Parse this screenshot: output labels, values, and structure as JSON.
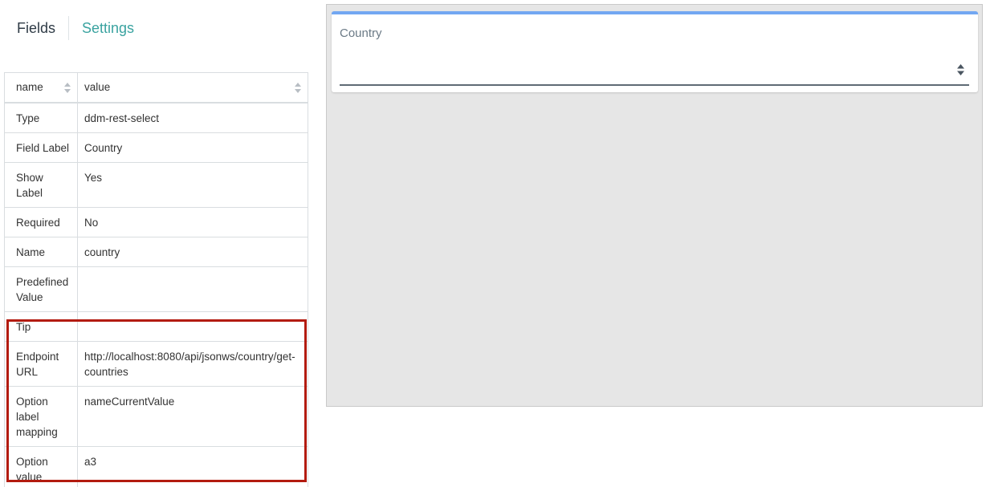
{
  "tabs": {
    "fields": "Fields",
    "settings": "Settings"
  },
  "table": {
    "headers": {
      "name": "name",
      "value": "value"
    },
    "rows": [
      {
        "name": "Type",
        "value": "ddm-rest-select"
      },
      {
        "name": "Field Label",
        "value": "Country"
      },
      {
        "name": "Show Label",
        "value": "Yes"
      },
      {
        "name": "Required",
        "value": "No"
      },
      {
        "name": "Name",
        "value": "country"
      },
      {
        "name": "Predefined Value",
        "value": ""
      },
      {
        "name": "Tip",
        "value": ""
      },
      {
        "name": "Endpoint URL",
        "value": "http://localhost:8080/api/jsonws/country/get-countries"
      },
      {
        "name": "Option label mapping",
        "value": "nameCurrentValue"
      },
      {
        "name": "Option value mapping",
        "value": "a3"
      }
    ]
  },
  "preview": {
    "field_label": "Country",
    "select_value": ""
  },
  "colors": {
    "accent_tab": "#3aa3a0",
    "card_top_border": "#72a7f2",
    "highlight": "#b31b0f"
  },
  "icons": {
    "sort": "sort-icon",
    "select_arrow": "select-arrows-icon"
  }
}
